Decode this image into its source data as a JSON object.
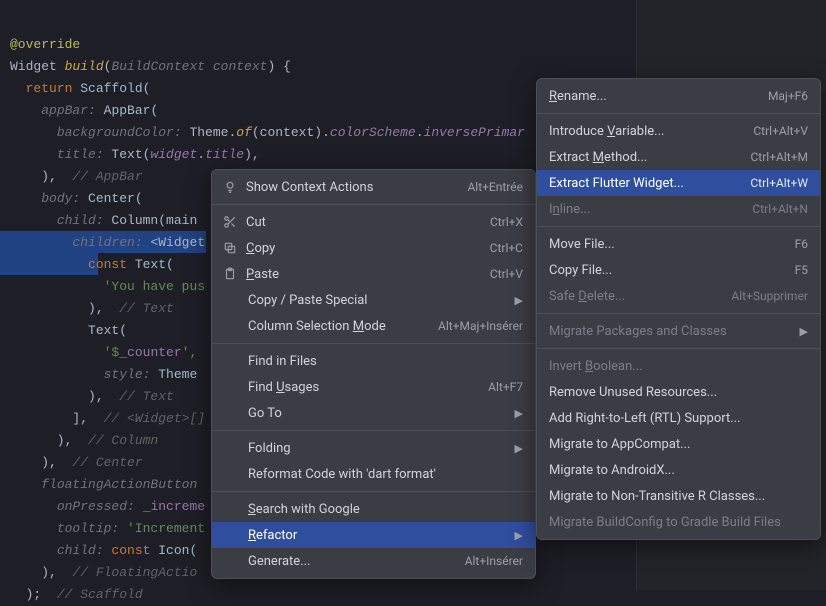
{
  "code": {
    "l1a": "@override",
    "l2_type": "Widget ",
    "l2_fn": "build",
    "l2_paren": "(",
    "l2_param": "BuildContext context",
    "l2_close": ") {",
    "l3_ret": "  return ",
    "l3_cls": "Scaffold",
    "l3_end": "(",
    "l4_g": "    ",
    "l4_lbl": "appBar: ",
    "l4_cls": "AppBar",
    "l4_end": "(",
    "l5_g": "      ",
    "l5_lbl": "backgroundColor: ",
    "l5_theme": "Theme",
    "l5_dot": ".",
    "l5_of": "of",
    "l5_ctx": "(context).",
    "l5_cs": "colorScheme",
    "l5_dot2": ".",
    "l5_ip": "inversePrimar",
    "l6_g": "      ",
    "l6_lbl": "title: ",
    "l6_text": "Text",
    "l6_p1": "(",
    "l6_w": "widget",
    "l6_dot": ".",
    "l6_ttl": "title",
    "l6_end": "),",
    "l7_g": "    ),  ",
    "l7_cmt": "// AppBar",
    "l8_g": "    ",
    "l8_lbl": "body: ",
    "l8_cls": "Center",
    "l8_end": "(",
    "l9_g": "      ",
    "l9_lbl": "child: ",
    "l9_cls": "Column",
    "l9_p": "(main",
    "l10_g": "        ",
    "l10_lbl": "children: ",
    "l10_val": "<Widget",
    "l11_g": "          ",
    "l11_const": "const ",
    "l11_cls": "Text",
    "l11_end": "(",
    "l12_g": "            ",
    "l12_str": "'You have pus",
    "l13_g": "          ),  ",
    "l13_cmt": "// Text",
    "l14_g": "          ",
    "l14_cls": "Text",
    "l14_end": "(",
    "l15_g": "            ",
    "l15_str": "'$",
    "l15_var": "_counter",
    "l15_end": "',",
    "l16_g": "            ",
    "l16_lbl": "style: ",
    "l16_theme": "Theme",
    "l17_g": "          ),  ",
    "l17_cmt": "// Text",
    "l18_g": "        ],  ",
    "l18_cmt": "// <Widget>[]",
    "l19_g": "      ),  ",
    "l19_cmt": "// Column",
    "l20_g": "    ),  ",
    "l20_cmt": "// Center",
    "l21_g": "    ",
    "l21_lbl": "floatingActionButton",
    "l22_g": "      ",
    "l22_lbl": "onPressed: ",
    "l22_val": "_increme",
    "l23_g": "      ",
    "l23_lbl": "tooltip: ",
    "l23_str": "'Increment",
    "l24_g": "      ",
    "l24_lbl": "child: ",
    "l24_const": "const ",
    "l24_cls": "Icon",
    "l24_end": "(",
    "l25_g": "    ),  ",
    "l25_cmt": "// FloatingActio",
    "l26_g": "  );  ",
    "l26_cmt": "// Scaffold"
  },
  "menu": {
    "show_context_actions": "Show Context Actions",
    "show_context_actions_sc": "Alt+Entrée",
    "cut": "Cut",
    "cut_sc": "Ctrl+X",
    "copy": "Copy",
    "copy_sc": "Ctrl+C",
    "paste": "Paste",
    "paste_sc": "Ctrl+V",
    "copy_paste_special": "Copy / Paste Special",
    "column_selection": "Column Selection Mode",
    "column_selection_sc": "Alt+Maj+Insérer",
    "find_in_files": "Find in Files",
    "find_usages": "Find Usages",
    "find_usages_sc": "Alt+F7",
    "go_to": "Go To",
    "folding": "Folding",
    "reformat": "Reformat Code with 'dart format'",
    "search_google": "Search with Google",
    "refactor": "Refactor",
    "generate": "Generate...",
    "generate_sc": "Alt+Insérer"
  },
  "submenu": {
    "rename": "Rename...",
    "rename_sc": "Maj+F6",
    "introduce_var": "Introduce Variable...",
    "introduce_var_sc": "Ctrl+Alt+V",
    "extract_method": "Extract Method...",
    "extract_method_sc": "Ctrl+Alt+M",
    "extract_flutter": "Extract Flutter Widget...",
    "extract_flutter_sc": "Ctrl+Alt+W",
    "inline": "Inline...",
    "inline_sc": "Ctrl+Alt+N",
    "move_file": "Move File...",
    "move_file_sc": "F6",
    "copy_file": "Copy File...",
    "copy_file_sc": "F5",
    "safe_delete": "Safe Delete...",
    "safe_delete_sc": "Alt+Supprimer",
    "migrate_pkg": "Migrate Packages and Classes",
    "invert_bool": "Invert Boolean...",
    "remove_unused": "Remove Unused Resources...",
    "add_rtl": "Add Right-to-Left (RTL) Support...",
    "migrate_appcompat": "Migrate to AppCompat...",
    "migrate_androidx": "Migrate to AndroidX...",
    "migrate_nontrans": "Migrate to Non-Transitive R Classes...",
    "migrate_buildcfg": "Migrate BuildConfig to Gradle Build Files"
  }
}
